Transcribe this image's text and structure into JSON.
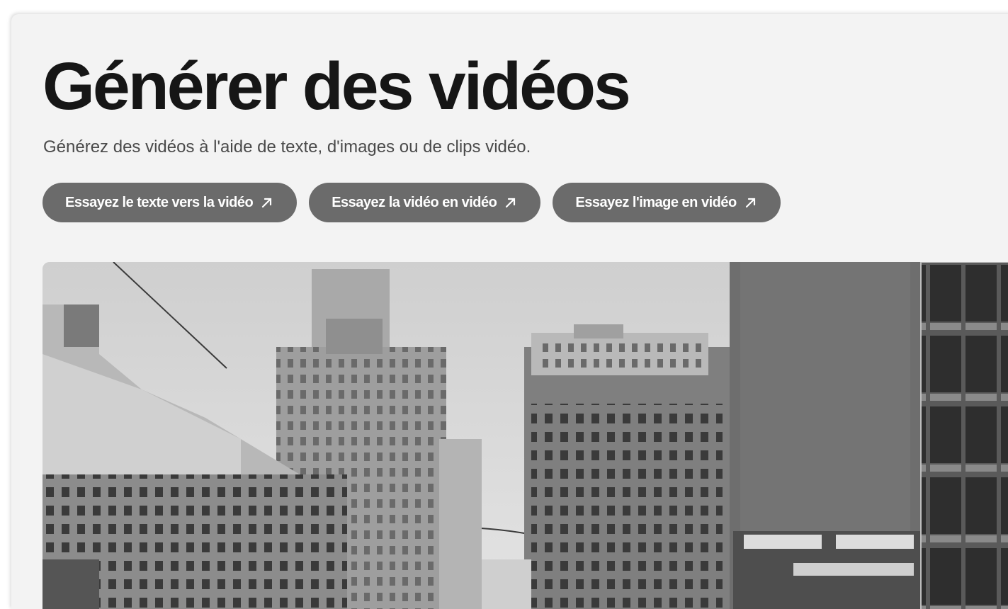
{
  "page": {
    "title": "Générer des vidéos",
    "subtitle": "Générez des vidéos à l'aide de texte, d'images ou de clips vidéo."
  },
  "actions": [
    {
      "label": "Essayez le texte vers la vidéo",
      "icon": "arrow-up-right-icon"
    },
    {
      "label": "Essayez la vidéo en vidéo",
      "icon": "arrow-up-right-icon"
    },
    {
      "label": "Essayez l'image en vidéo",
      "icon": "arrow-up-right-icon"
    }
  ],
  "hero_image": {
    "subject": "black-and-white city street with tall buildings"
  },
  "colors": {
    "card_background": "#f3f3f3",
    "pill_background": "#6b6b6b",
    "title_text": "#161616"
  }
}
